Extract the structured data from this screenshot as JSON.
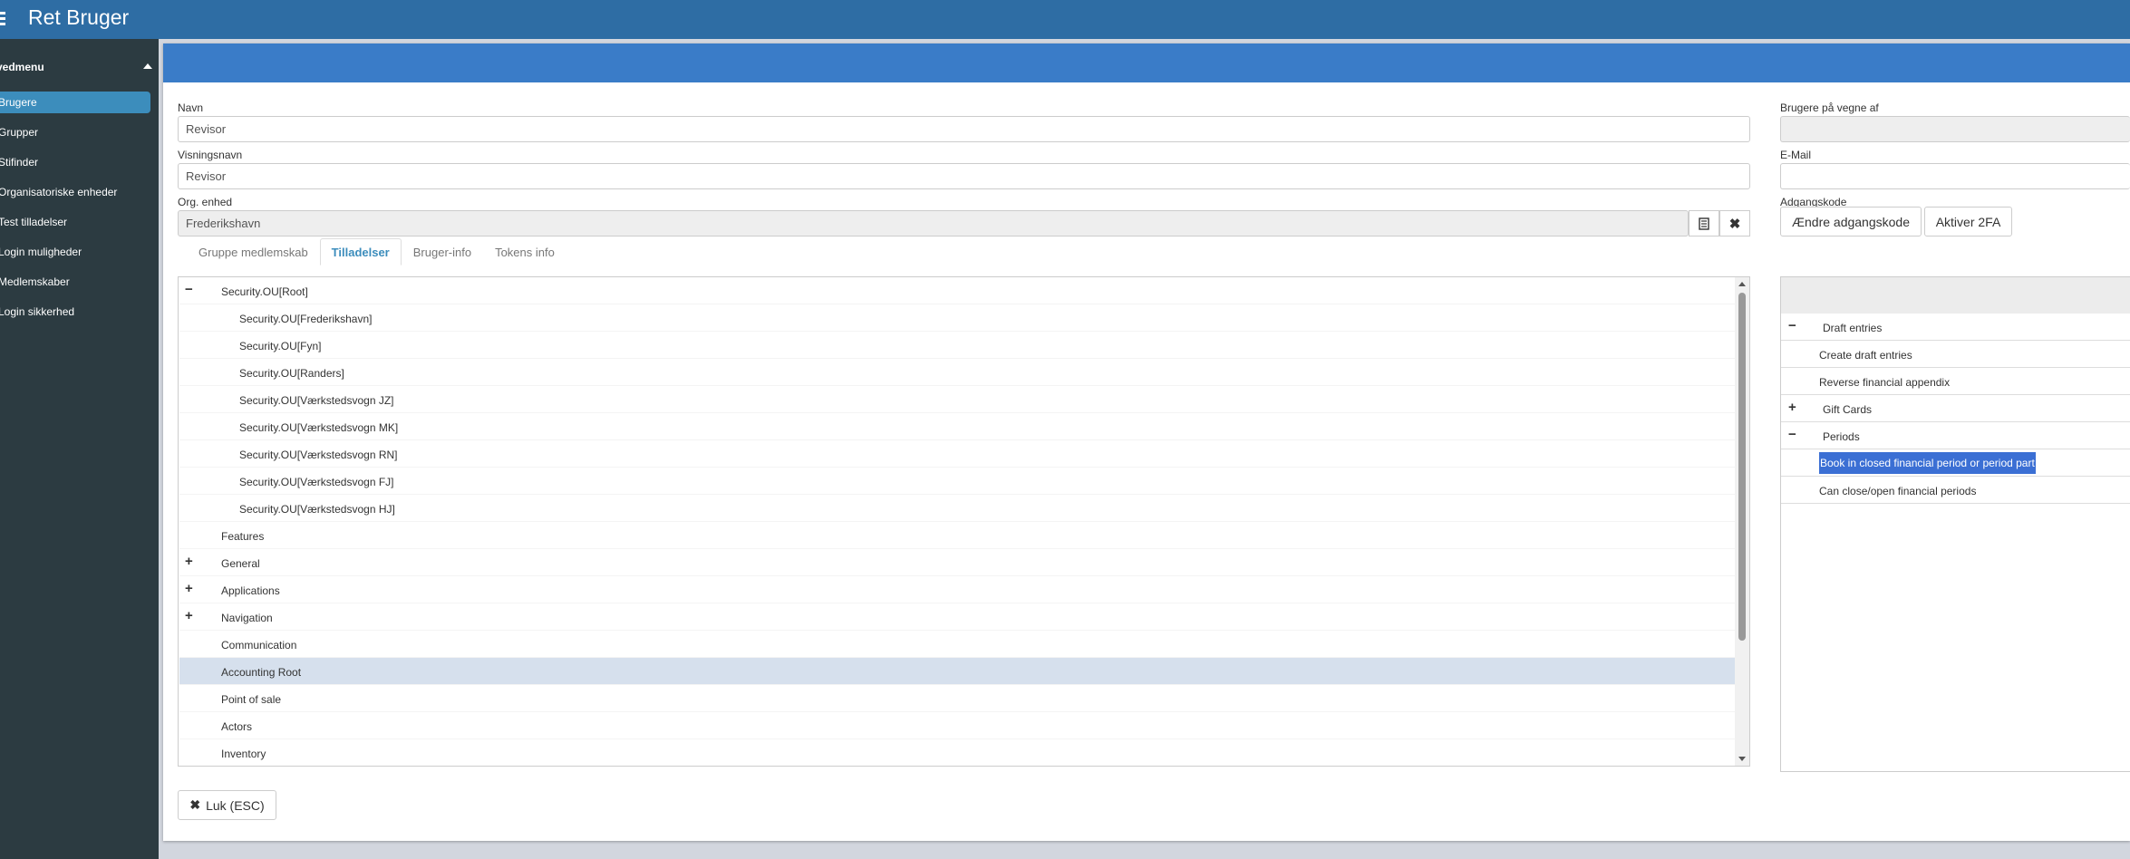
{
  "header": {
    "title": "Ret Bruger"
  },
  "sidebar": {
    "heading": "vedmenu",
    "items": [
      {
        "label": "Brugere"
      },
      {
        "label": "Grupper"
      },
      {
        "label": "Stifinder"
      },
      {
        "label": "Organisatoriske enheder"
      },
      {
        "label": "Test tilladelser"
      },
      {
        "label": "Login muligheder"
      },
      {
        "label": "Medlemskaber"
      },
      {
        "label": "Login sikkerhed"
      }
    ],
    "active_index": 0
  },
  "form": {
    "navn_label": "Navn",
    "navn_value": "Revisor",
    "visningsnavn_label": "Visningsnavn",
    "visningsnavn_value": "Revisor",
    "org_label": "Org. enhed",
    "org_value": "Frederikshavn",
    "paa_vegne_label": "Brugere på vegne af",
    "paa_vegne_value": "",
    "email_label": "E-Mail",
    "email_value": "",
    "adgangskode_label": "Adgangskode",
    "change_password_button": "Ændre adgangskode",
    "activate_2fa_button": "Aktiver 2FA"
  },
  "tabs": [
    {
      "label": "Gruppe medlemskab",
      "active": false
    },
    {
      "label": "Tilladelser",
      "active": true
    },
    {
      "label": "Bruger-info",
      "active": false
    },
    {
      "label": "Tokens info",
      "active": false
    }
  ],
  "tree": {
    "rows": [
      {
        "label": "Security.OU[Root]",
        "expander": "−",
        "level": 0
      },
      {
        "label": "Security.OU[Frederikshavn]",
        "expander": "",
        "level": 1
      },
      {
        "label": "Security.OU[Fyn]",
        "expander": "",
        "level": 1
      },
      {
        "label": "Security.OU[Randers]",
        "expander": "",
        "level": 1
      },
      {
        "label": "Security.OU[Værkstedsvogn JZ]",
        "expander": "",
        "level": 1
      },
      {
        "label": "Security.OU[Værkstedsvogn MK]",
        "expander": "",
        "level": 1
      },
      {
        "label": "Security.OU[Værkstedsvogn RN]",
        "expander": "",
        "level": 1
      },
      {
        "label": "Security.OU[Værkstedsvogn FJ]",
        "expander": "",
        "level": 1
      },
      {
        "label": "Security.OU[Værkstedsvogn HJ]",
        "expander": "",
        "level": 1
      },
      {
        "label": "Features",
        "expander": "",
        "level": 0
      },
      {
        "label": "General",
        "expander": "+",
        "level": 0
      },
      {
        "label": "Applications",
        "expander": "+",
        "level": 0
      },
      {
        "label": "Navigation",
        "expander": "+",
        "level": 0
      },
      {
        "label": "Communication",
        "expander": "",
        "level": 0
      },
      {
        "label": "Accounting Root",
        "expander": "",
        "level": 0,
        "highlight": true
      },
      {
        "label": "Point of sale",
        "expander": "",
        "level": 0
      },
      {
        "label": "Actors",
        "expander": "",
        "level": 0
      },
      {
        "label": "Inventory",
        "expander": "",
        "level": 0
      }
    ]
  },
  "permissions": {
    "rows": [
      {
        "label": "Draft entries",
        "expander": "−",
        "level": 0
      },
      {
        "label": "Create draft entries",
        "expander": "",
        "level": 1
      },
      {
        "label": "Reverse financial appendix",
        "expander": "",
        "level": 1
      },
      {
        "label": "Gift Cards",
        "expander": "+",
        "level": 0
      },
      {
        "label": "Periods",
        "expander": "−",
        "level": 0
      },
      {
        "label": "Book in closed financial period or period part",
        "expander": "",
        "level": 1,
        "selected": true
      },
      {
        "label": "Can close/open financial periods",
        "expander": "",
        "level": 1
      }
    ]
  },
  "footer": {
    "close_button": "Luk (ESC)"
  },
  "colors": {
    "header": "#2e6da4",
    "panel_header": "#3a7cc8",
    "sidebar": "#2c3b41",
    "sidebar_active": "#3c8dbc",
    "row_highlight": "#d6e0ed",
    "selection": "#3b6fd4"
  }
}
